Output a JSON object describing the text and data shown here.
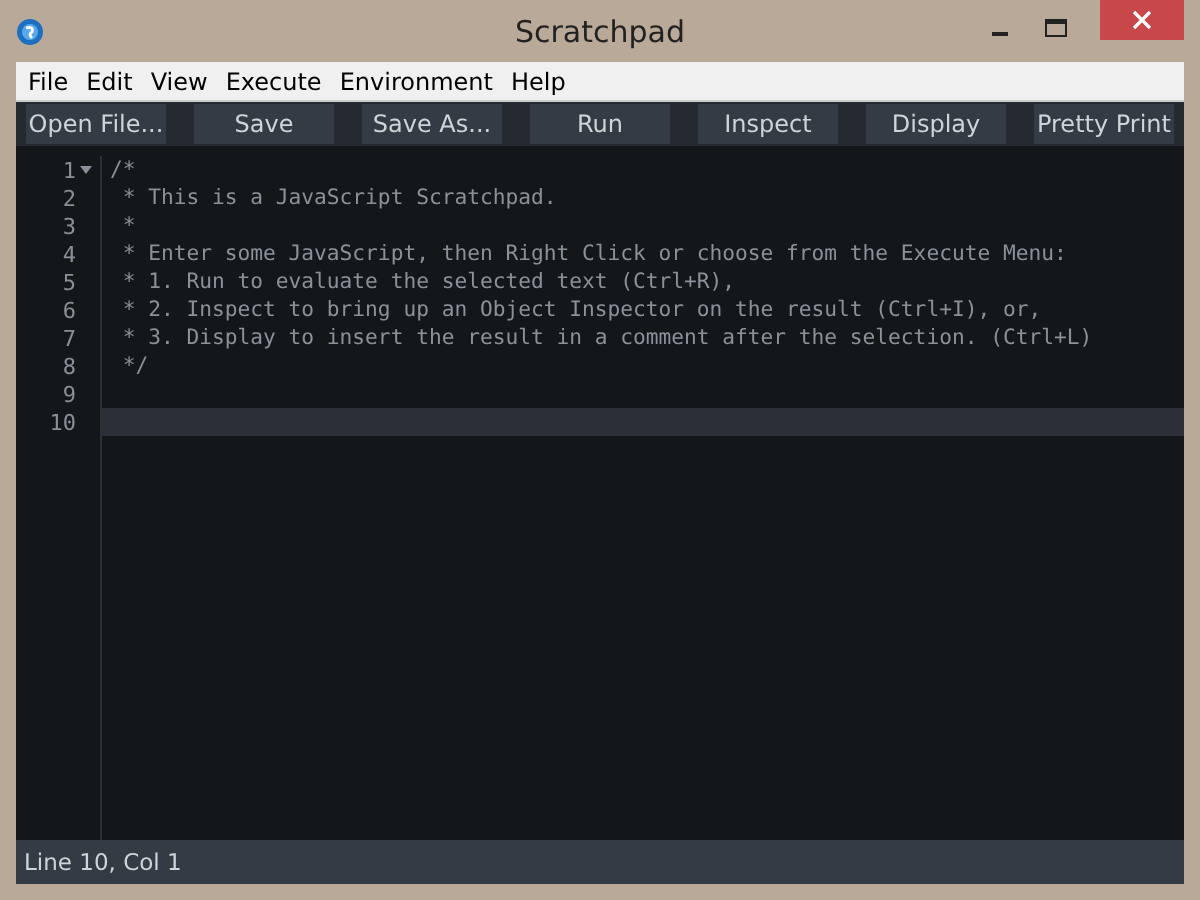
{
  "window": {
    "title": "Scratchpad"
  },
  "menu": [
    "File",
    "Edit",
    "View",
    "Execute",
    "Environment",
    "Help"
  ],
  "toolbar": [
    "Open File...",
    "Save",
    "Save As...",
    "Run",
    "Inspect",
    "Display",
    "Pretty Print"
  ],
  "editor": {
    "lines": [
      {
        "number": "1",
        "text": "/*",
        "foldable": true,
        "current": false
      },
      {
        "number": "2",
        "text": " * This is a JavaScript Scratchpad.",
        "foldable": false,
        "current": false
      },
      {
        "number": "3",
        "text": " *",
        "foldable": false,
        "current": false
      },
      {
        "number": "4",
        "text": " * Enter some JavaScript, then Right Click or choose from the Execute Menu:",
        "foldable": false,
        "current": false
      },
      {
        "number": "5",
        "text": " * 1. Run to evaluate the selected text (Ctrl+R),",
        "foldable": false,
        "current": false
      },
      {
        "number": "6",
        "text": " * 2. Inspect to bring up an Object Inspector on the result (Ctrl+I), or,",
        "foldable": false,
        "current": false
      },
      {
        "number": "7",
        "text": " * 3. Display to insert the result in a comment after the selection. (Ctrl+L)",
        "foldable": false,
        "current": false
      },
      {
        "number": "8",
        "text": " */",
        "foldable": false,
        "current": false
      },
      {
        "number": "9",
        "foldable": false,
        "current": false
      },
      {
        "number": "10",
        "foldable": false,
        "current": true
      }
    ]
  },
  "status_bar": "Line 10, Col 1"
}
